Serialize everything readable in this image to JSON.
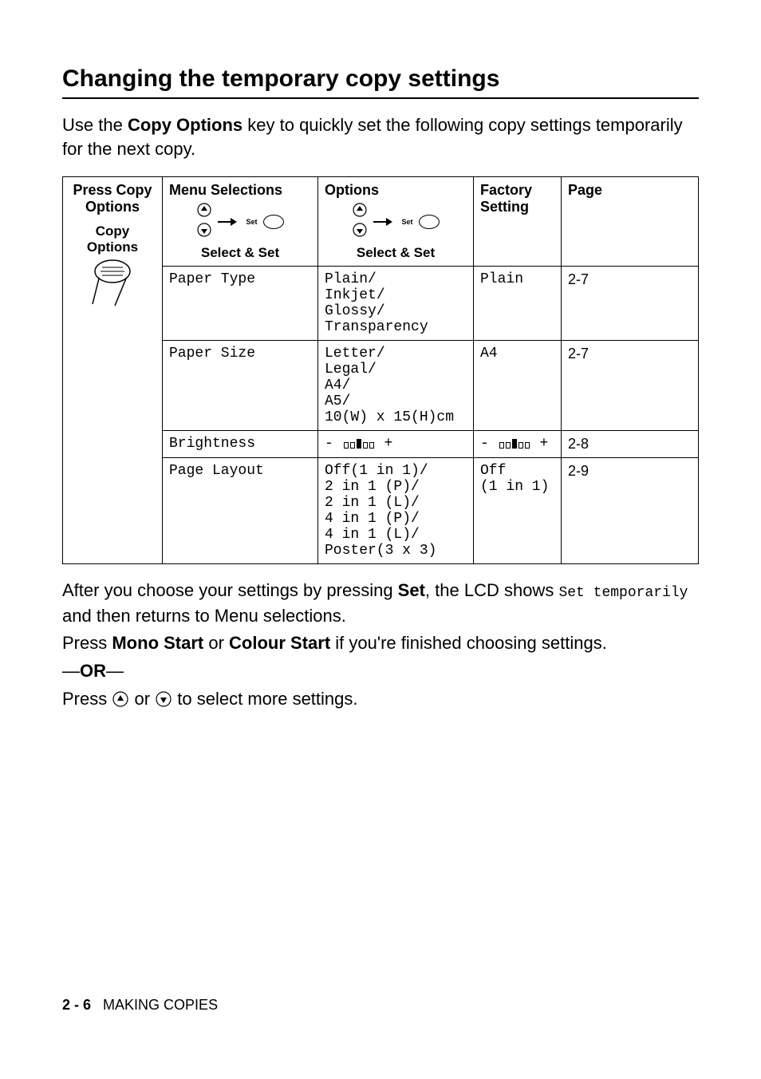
{
  "heading": "Changing the temporary copy settings",
  "intro_prefix": "Use the ",
  "intro_bold": "Copy Options",
  "intro_suffix": " key to quickly set the following copy settings temporarily for the next copy.",
  "table": {
    "headers": {
      "col1_line1": "Press Copy",
      "col1_line2": "Options",
      "col1_sub1": "Copy",
      "col1_sub2": "Options",
      "col2": "Menu Selections",
      "col3": "Options",
      "col4_line1": "Factory",
      "col4_line2": "Setting",
      "col5": "Page",
      "select_set": "Select & Set",
      "set_icon_label": "Set"
    },
    "rows": [
      {
        "menu": "Paper Type",
        "options": [
          "Plain",
          "Inkjet",
          "Glossy",
          "Transparency"
        ],
        "factory": "Plain",
        "page": "2-7"
      },
      {
        "menu": "Paper Size",
        "options": [
          "Letter",
          "Legal",
          "A4",
          "A5",
          "10(W) x 15(H)cm"
        ],
        "factory": "A4",
        "page": "2-7"
      },
      {
        "menu": "Brightness",
        "options_type": "brightness",
        "factory_type": "brightness",
        "page": "2-8"
      },
      {
        "menu": "Page Layout",
        "options": [
          "Off(1 in 1)",
          "2 in 1 (P)",
          "2 in 1 (L)",
          "4 in 1 (P)",
          "4 in 1 (L)",
          "Poster(3 x 3)"
        ],
        "factory_lines": [
          "Off",
          "(1 in 1)"
        ],
        "page": "2-9"
      }
    ]
  },
  "after": {
    "p1_prefix": "After you choose your settings by pressing ",
    "p1_bold": "Set",
    "p1_mid": ", the LCD shows ",
    "p1_mono": "Set temporarily",
    "p1_suffix": " and then returns to Menu selections.",
    "p2_prefix": "Press ",
    "p2_bold1": "Mono Start",
    "p2_mid1": " or ",
    "p2_bold2": "Colour Start",
    "p2_suffix1": " if you",
    "p2_apos": "'",
    "p2_suffix2": "re finished choosing settings.",
    "or_dash": "—",
    "or_text": "OR",
    "p3_prefix": "Press ",
    "p3_mid": " or ",
    "p3_suffix": " to select more settings."
  },
  "footer": {
    "page_num": "2 - 6",
    "section": "MAKING COPIES"
  },
  "minus": "-",
  "plus": "+"
}
